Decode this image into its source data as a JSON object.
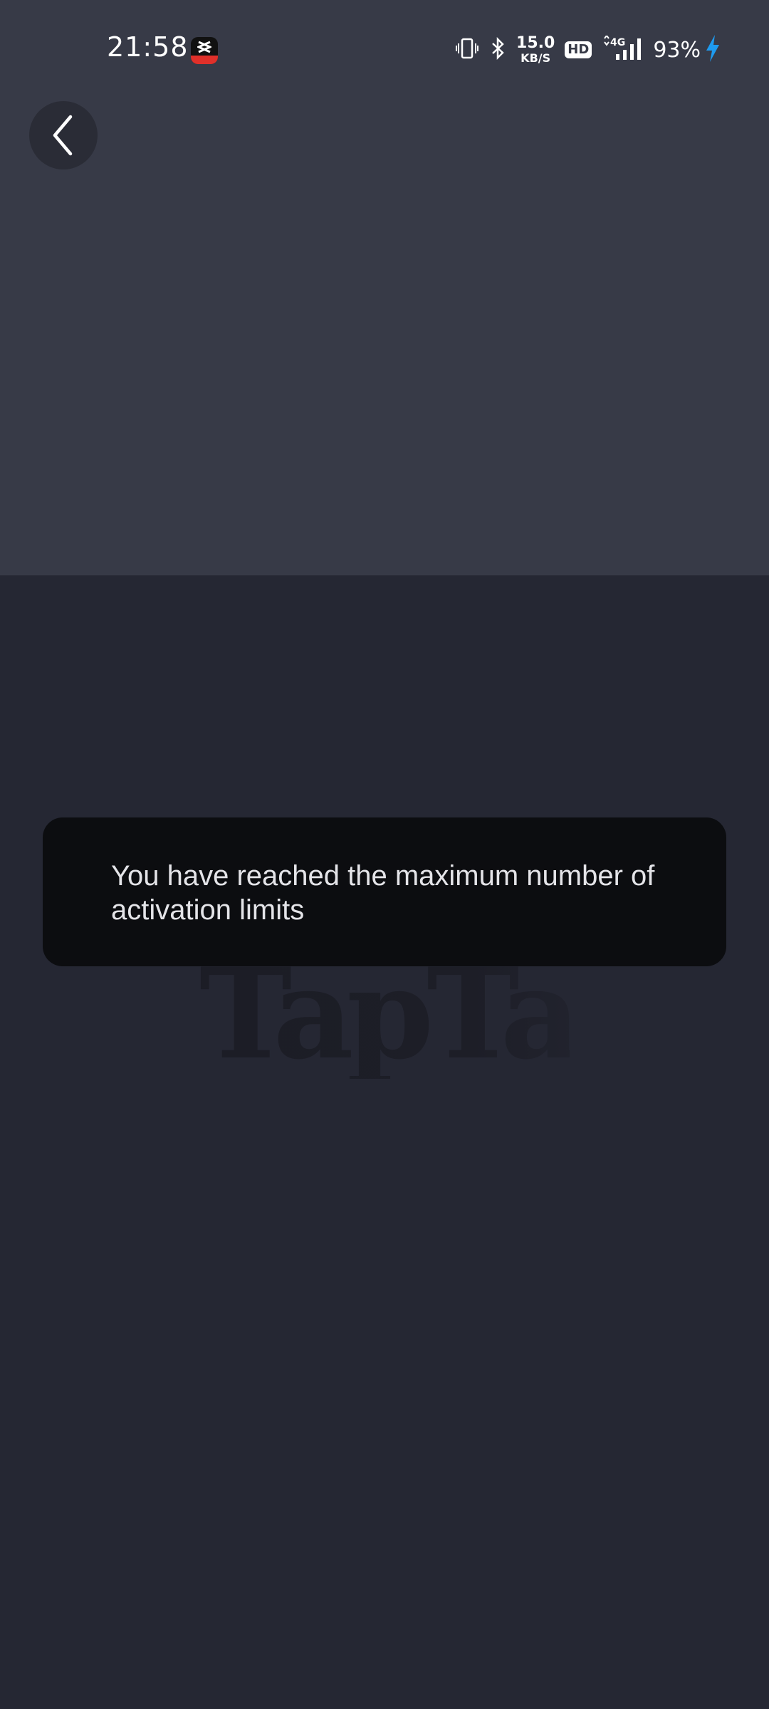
{
  "status_bar": {
    "time": "21:58",
    "net_speed_value": "15.0",
    "net_speed_unit": "KB/S",
    "hd_label": "HD",
    "network_type": "4G",
    "battery_percent": "93%",
    "charging_color": "#1e9bf0"
  },
  "icons": {
    "back": "chevron-left-icon",
    "vibrate": "vibrate-icon",
    "bluetooth": "bluetooth-icon",
    "signal": "signal-icon",
    "charging": "lightning-icon",
    "app_notification": "capcut-icon"
  },
  "logo": {
    "text": "TapTap"
  },
  "toast": {
    "message": "You have reached the maximum number of activation limits"
  },
  "colors": {
    "header_bg": "#373a47",
    "page_bg": "#252733",
    "toast_bg": "#0c0d10"
  }
}
